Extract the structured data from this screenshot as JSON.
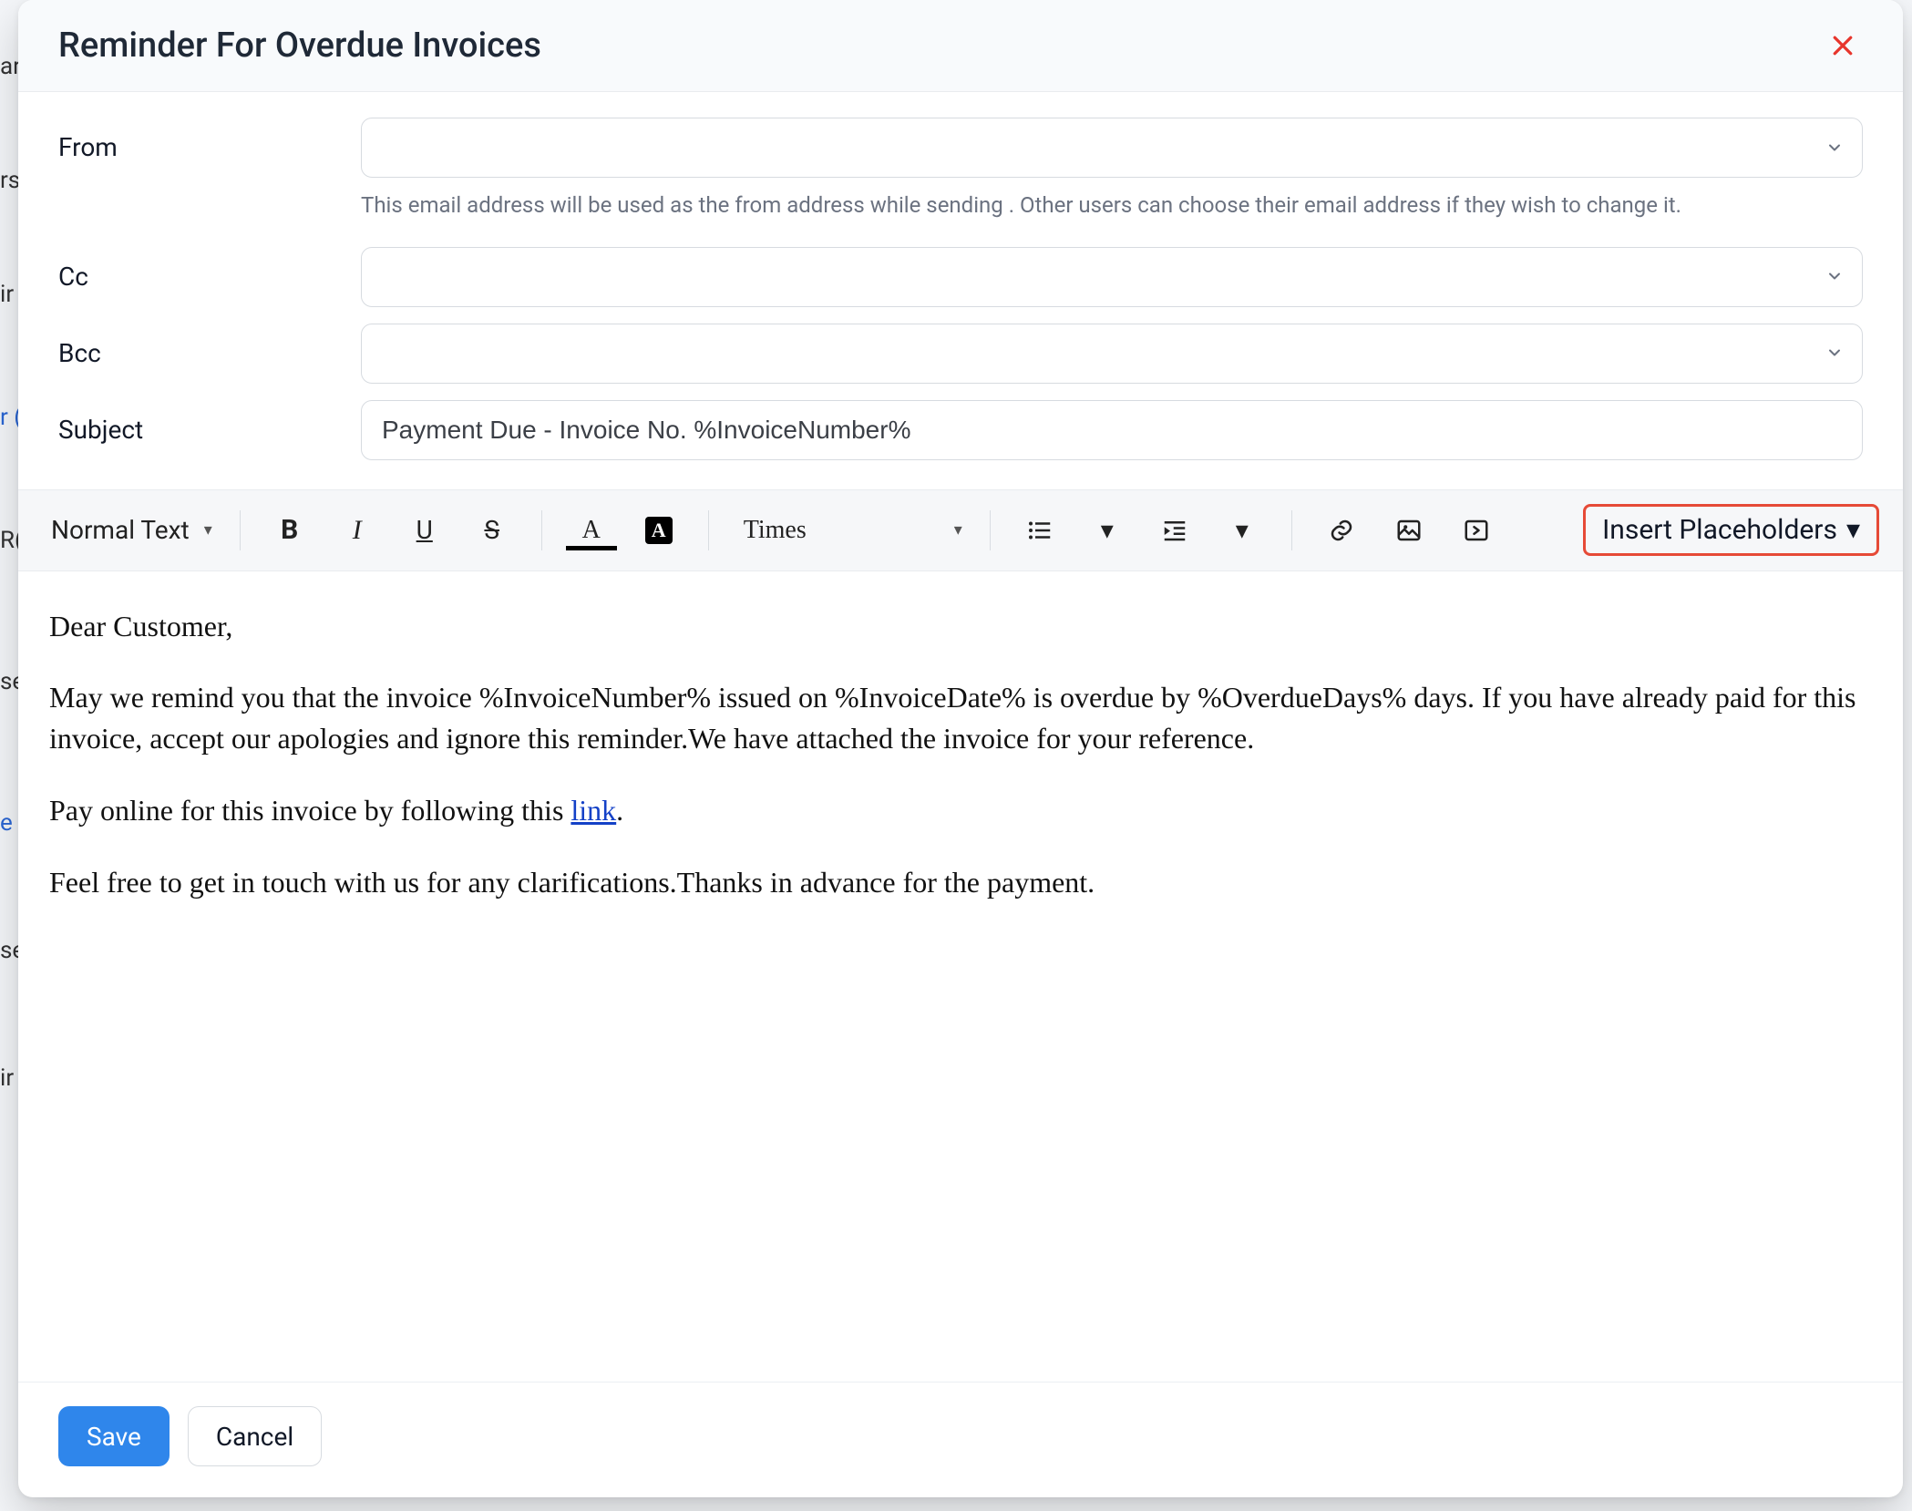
{
  "background": {
    "line1": "ar",
    "line2": "rs",
    "line3": "ir",
    "line4": "r (",
    "line5": "R(",
    "line6": "se",
    "line7": "e",
    "line8": "se",
    "line9": "ir"
  },
  "modal": {
    "title": "Reminder For Overdue Invoices",
    "close_icon": "close-icon"
  },
  "form": {
    "from": {
      "label": "From",
      "value": "",
      "hint": "This email address will be used as the from address while sending . Other users can choose their email address if they wish to change it."
    },
    "cc": {
      "label": "Cc",
      "value": ""
    },
    "bcc": {
      "label": "Bcc",
      "value": ""
    },
    "subject": {
      "label": "Subject",
      "value": "Payment Due - Invoice No. %InvoiceNumber%"
    }
  },
  "toolbar": {
    "text_style": "Normal Text",
    "font_family": "Times",
    "insert_placeholders": "Insert Placeholders",
    "icons": {
      "bold": "B",
      "italic": "I",
      "underline": "U",
      "strike": "S",
      "font_color": "A",
      "bg_color": "A"
    }
  },
  "editor": {
    "greeting": "Dear Customer,",
    "body1": "May we remind you that the invoice %InvoiceNumber% issued on %InvoiceDate% is overdue by %OverdueDays% days. If you have already paid for this invoice, accept our apologies and ignore this reminder.We have attached the invoice for your reference.",
    "pay_prefix": "Pay online for this invoice by following this ",
    "pay_link_text": "link",
    "pay_suffix": ".",
    "closing": "Feel free to get in touch with us for any clarifications.Thanks in advance for the payment."
  },
  "footer": {
    "save": "Save",
    "cancel": "Cancel"
  }
}
